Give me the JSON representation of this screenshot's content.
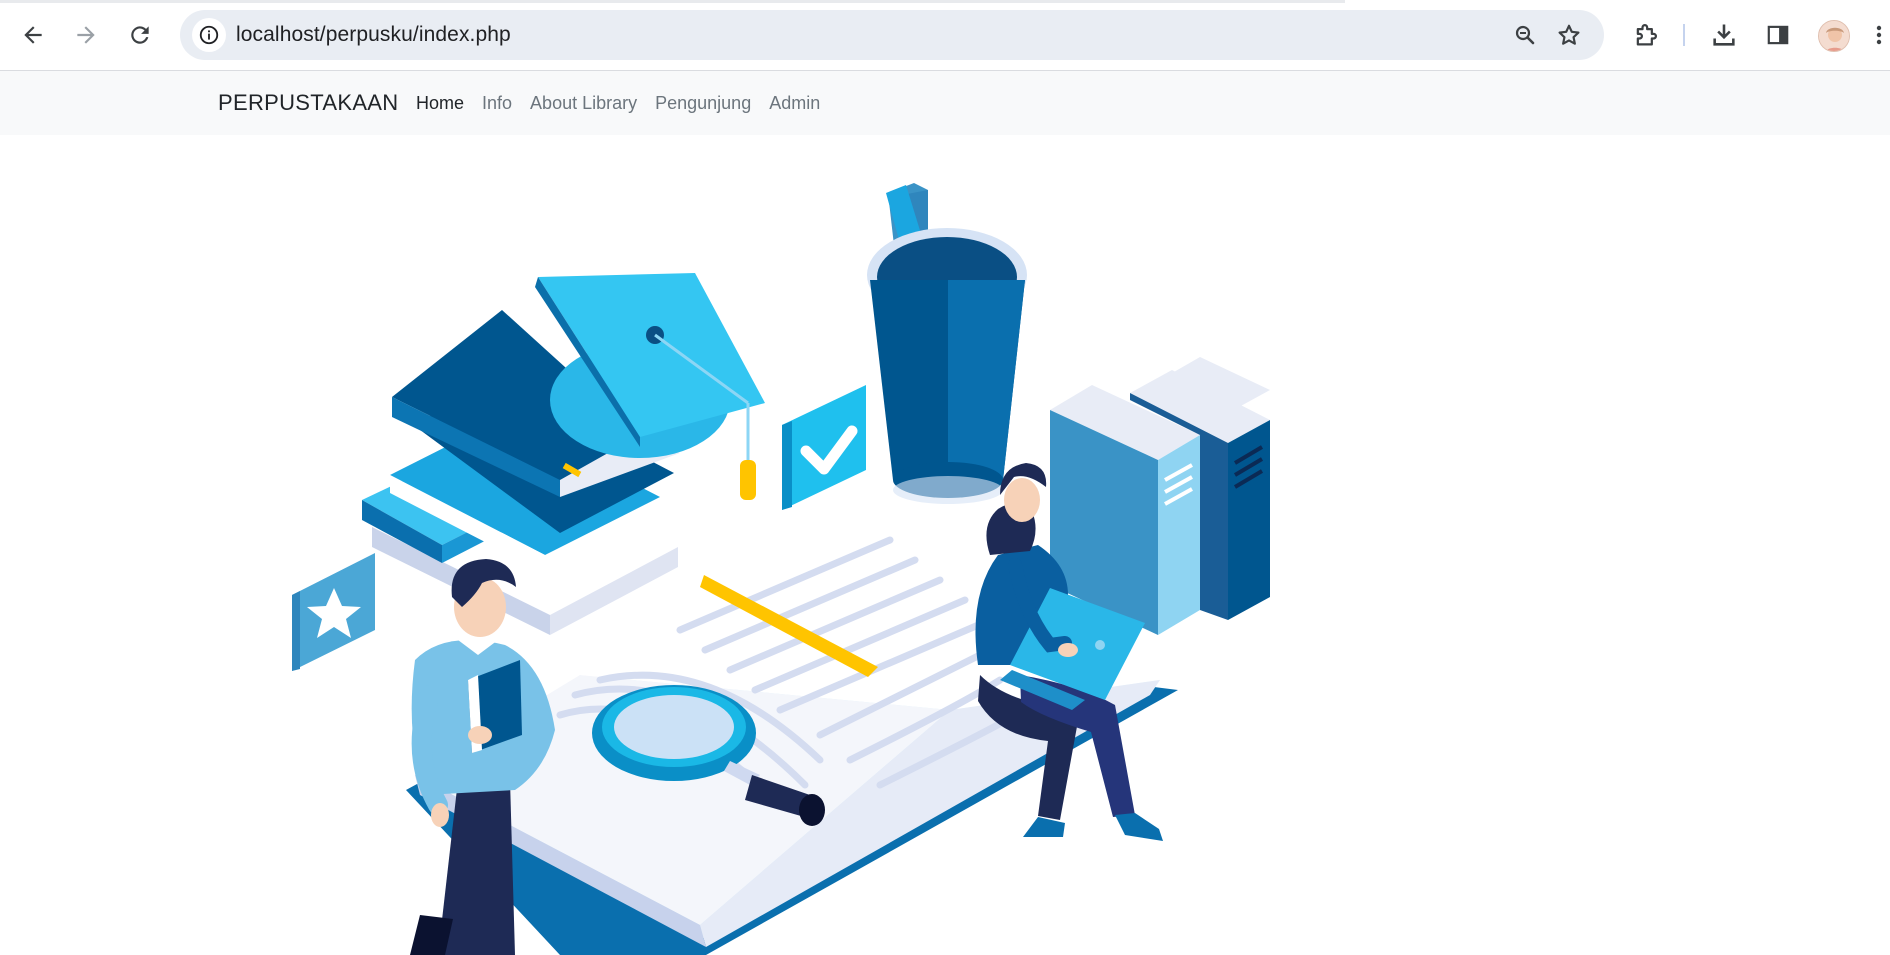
{
  "browser": {
    "url": "localhost/perpusku/index.php",
    "icons": {
      "back": "arrow-left-icon",
      "forward": "arrow-right-icon",
      "reload": "reload-icon",
      "site_info": "info-icon",
      "zoom": "zoom-icon",
      "bookmark": "star-icon",
      "extensions": "puzzle-icon",
      "downloads": "download-icon",
      "side_panel": "side-panel-icon",
      "profile": "avatar",
      "menu": "kebab-menu-icon"
    }
  },
  "navbar": {
    "brand": "PERPUSTAKAAN",
    "links": [
      {
        "label": "Home",
        "active": true
      },
      {
        "label": "Info",
        "active": false
      },
      {
        "label": "About Library",
        "active": false
      },
      {
        "label": "Pengunjung",
        "active": false
      },
      {
        "label": "Admin",
        "active": false
      }
    ]
  },
  "colors": {
    "primary_dark": "#00568f",
    "primary": "#0a6fae",
    "light_blue": "#3cc3f1",
    "sky": "#8fd4f2",
    "accent_yellow": "#ffc400",
    "navy": "#1f2d63",
    "page_lines": "#d4dcf0"
  }
}
